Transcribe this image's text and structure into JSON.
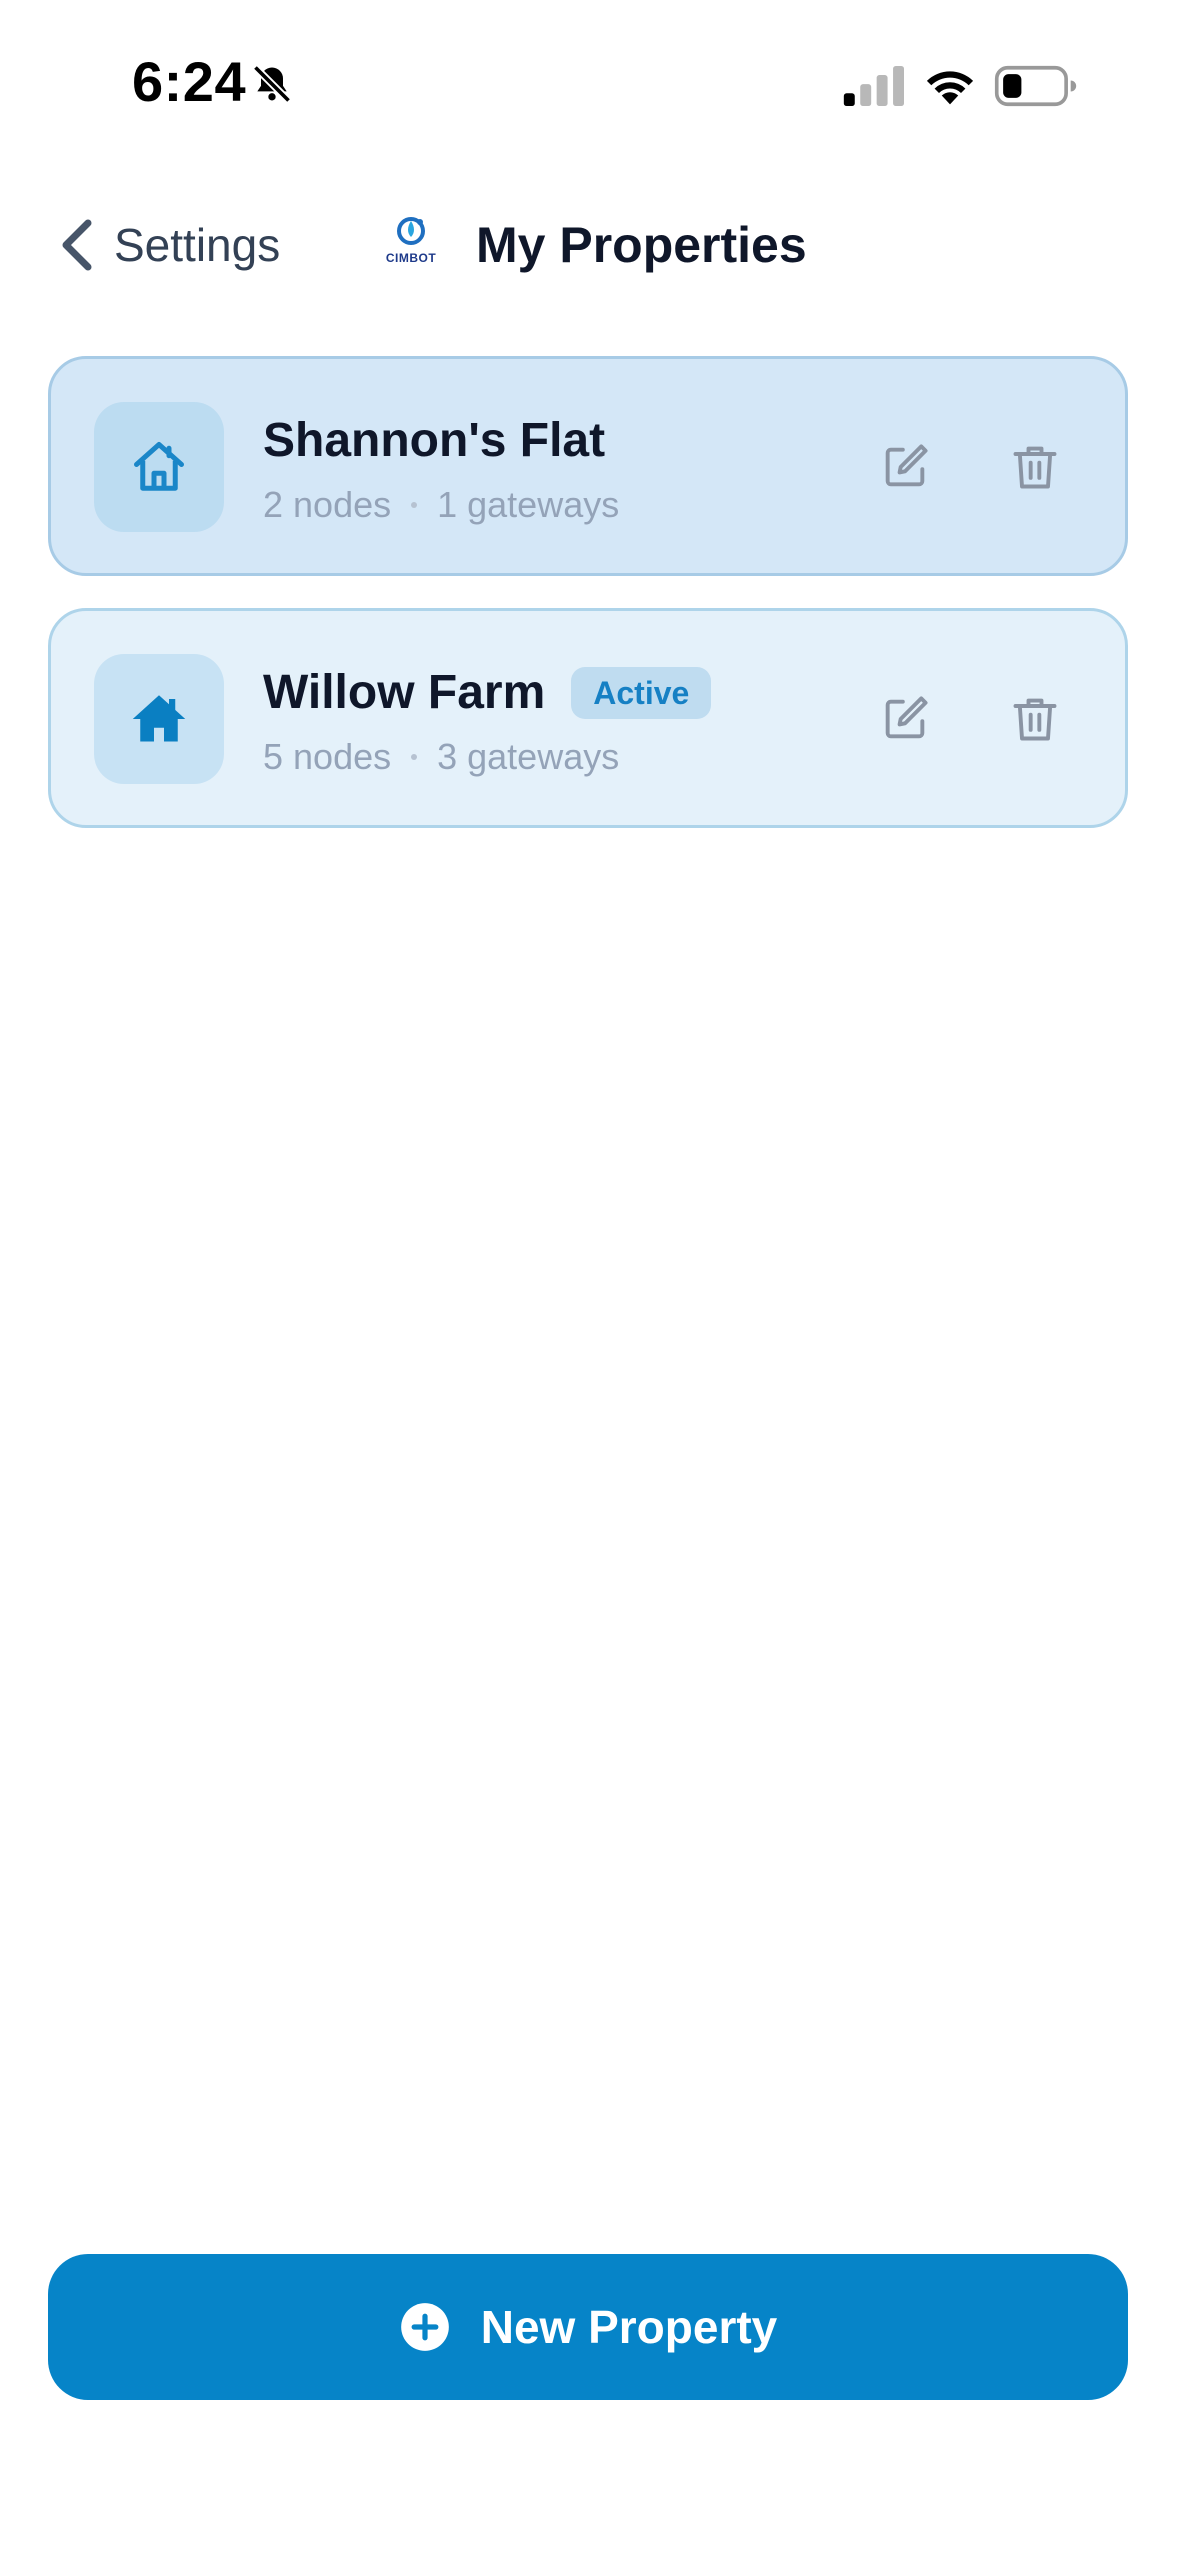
{
  "status_bar": {
    "time": "6:24",
    "icons": [
      "bell-slash-icon",
      "cellular-signal-icon",
      "wifi-icon",
      "battery-icon"
    ]
  },
  "nav": {
    "back_label": "Settings",
    "title": "My Properties",
    "logo_text": "CIMBOT"
  },
  "properties": [
    {
      "name": "Shannon's Flat",
      "nodes": "2 nodes",
      "gateways": "1 gateways",
      "active": false,
      "badge": ""
    },
    {
      "name": "Willow Farm",
      "nodes": "5 nodes",
      "gateways": "3 gateways",
      "active": true,
      "badge": "Active"
    }
  ],
  "primary_action": {
    "label": "New Property",
    "icon": "plus-circle-icon"
  },
  "colors": {
    "accent": "#0684c8",
    "card_bg": "#d4e7f7",
    "card_active_bg": "#e4f1fa",
    "badge_text": "#1680c4",
    "muted_text": "#94a3b8"
  }
}
